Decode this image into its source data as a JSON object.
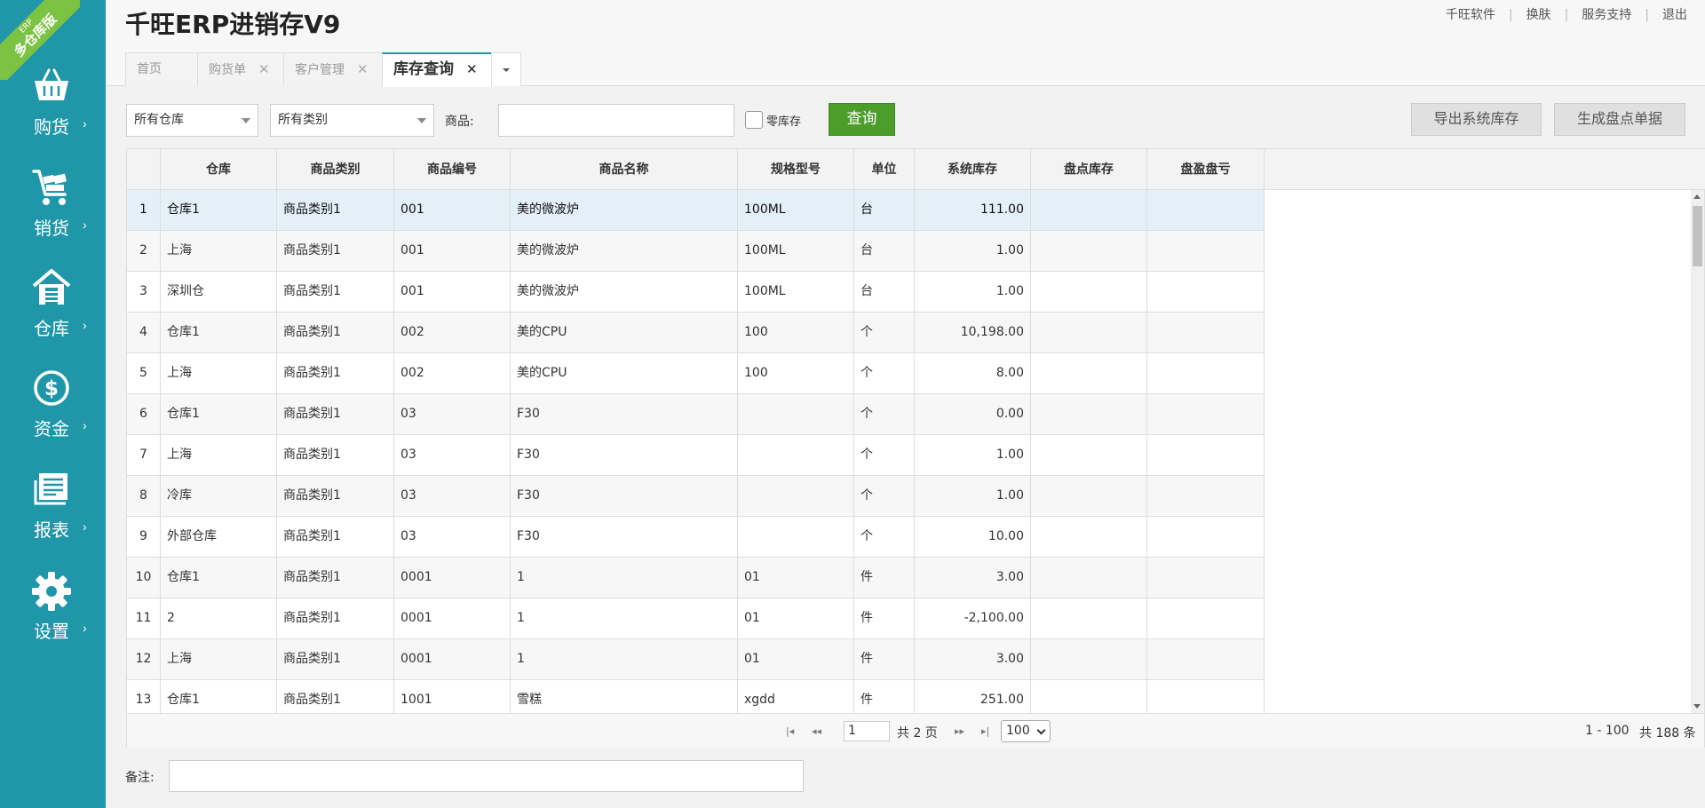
{
  "ribbon": {
    "line1": "ERP",
    "line2": "多仓库版"
  },
  "sidebar": {
    "items": [
      {
        "label": "购货",
        "icon": "basket-icon"
      },
      {
        "label": "销货",
        "icon": "cart-icon"
      },
      {
        "label": "仓库",
        "icon": "warehouse-icon"
      },
      {
        "label": "资金",
        "icon": "dollar-icon"
      },
      {
        "label": "报表",
        "icon": "report-icon"
      },
      {
        "label": "设置",
        "icon": "gear-icon"
      }
    ],
    "chevron": "›"
  },
  "header": {
    "title": "千旺ERP进销存V9",
    "links": [
      "千旺软件",
      "换肤",
      "服务支持",
      "退出"
    ]
  },
  "tabs": [
    {
      "label": "首页"
    },
    {
      "label": "购货单",
      "close": "✕"
    },
    {
      "label": "客户管理",
      "close": "✕"
    },
    {
      "label": "库存查询",
      "close": "✕",
      "active": true
    }
  ],
  "toolbar": {
    "warehouse_select": "所有仓库",
    "category_select": "所有类别",
    "product_label": "商品:",
    "product_value": "",
    "zero_stock_label": "零库存",
    "zero_stock_checked": false,
    "query_button": "查询",
    "export_button": "导出系统库存",
    "generate_button": "生成盘点单据"
  },
  "table": {
    "columns": [
      "",
      "仓库",
      "商品类别",
      "商品编号",
      "商品名称",
      "规格型号",
      "单位",
      "系统库存",
      "盘点库存",
      "盘盈盘亏"
    ],
    "rows": [
      [
        "1",
        "仓库1",
        "商品类别1",
        "001",
        "美的微波炉",
        "100ML",
        "台",
        "111.00",
        "",
        ""
      ],
      [
        "2",
        "上海",
        "商品类别1",
        "001",
        "美的微波炉",
        "100ML",
        "台",
        "1.00",
        "",
        ""
      ],
      [
        "3",
        "深圳仓",
        "商品类别1",
        "001",
        "美的微波炉",
        "100ML",
        "台",
        "1.00",
        "",
        ""
      ],
      [
        "4",
        "仓库1",
        "商品类别1",
        "002",
        "美的CPU",
        "100",
        "个",
        "10,198.00",
        "",
        ""
      ],
      [
        "5",
        "上海",
        "商品类别1",
        "002",
        "美的CPU",
        "100",
        "个",
        "8.00",
        "",
        ""
      ],
      [
        "6",
        "仓库1",
        "商品类别1",
        "03",
        "F30",
        "",
        "个",
        "0.00",
        "",
        ""
      ],
      [
        "7",
        "上海",
        "商品类别1",
        "03",
        "F30",
        "",
        "个",
        "1.00",
        "",
        ""
      ],
      [
        "8",
        "冷库",
        "商品类别1",
        "03",
        "F30",
        "",
        "个",
        "1.00",
        "",
        ""
      ],
      [
        "9",
        "外部仓库",
        "商品类别1",
        "03",
        "F30",
        "",
        "个",
        "10.00",
        "",
        ""
      ],
      [
        "10",
        "仓库1",
        "商品类别1",
        "0001",
        "1",
        "01",
        "件",
        "3.00",
        "",
        ""
      ],
      [
        "11",
        "2",
        "商品类别1",
        "0001",
        "1",
        "01",
        "件",
        "-2,100.00",
        "",
        ""
      ],
      [
        "12",
        "上海",
        "商品类别1",
        "0001",
        "1",
        "01",
        "件",
        "3.00",
        "",
        ""
      ],
      [
        "13",
        "仓库1",
        "商品类别1",
        "1001",
        "雪糕",
        "xgdd",
        "件",
        "251.00",
        "",
        ""
      ]
    ],
    "selected_row": 0
  },
  "pager": {
    "page": "1",
    "total_pages_text": "共 2 页",
    "page_size": "100",
    "range_text": "1 - 100",
    "total_text": "共 188 条"
  },
  "remark": {
    "label": "备注:",
    "value": ""
  },
  "colors": {
    "sidebar": "#1f97a8",
    "accent_green": "#4c9d2a",
    "ribbon": "#7cc243",
    "selected_row": "#e3f0f8"
  }
}
